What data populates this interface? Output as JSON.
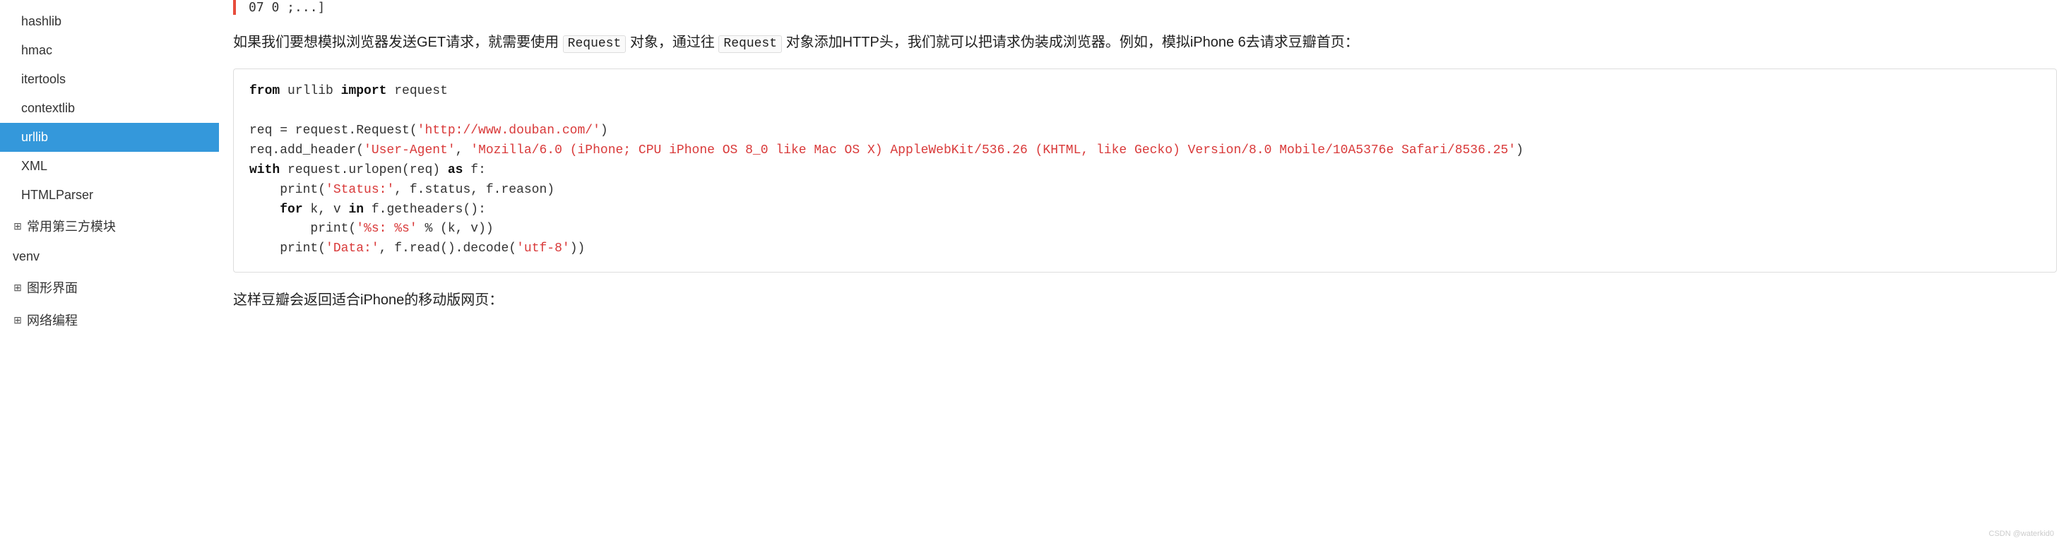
{
  "sidebar": {
    "items": [
      {
        "label": "hashlib",
        "active": false
      },
      {
        "label": "hmac",
        "active": false
      },
      {
        "label": "itertools",
        "active": false
      },
      {
        "label": "contextlib",
        "active": false
      },
      {
        "label": "urllib",
        "active": true
      },
      {
        "label": "XML",
        "active": false
      },
      {
        "label": "HTMLParser",
        "active": false
      }
    ],
    "sections": [
      {
        "label": "常用第三方模块"
      },
      {
        "label": "venv"
      },
      {
        "label": "图形界面"
      },
      {
        "label": "网络编程"
      }
    ]
  },
  "content": {
    "top_code_tail": "07 0 ;...]",
    "para1_prefix": "如果我们要想模拟浏览器发送GET请求，就需要使用 ",
    "inline1": "Request",
    "para1_mid": " 对象，通过往 ",
    "inline2": "Request",
    "para1_suffix": " 对象添加HTTP头，我们就可以把请求伪装成浏览器。例如，模拟iPhone 6去请求豆瓣首页：",
    "code": {
      "l1_kw1": "from",
      "l1_mod": " urllib ",
      "l1_kw2": "import",
      "l1_name": " request",
      "l3": "req = request.Request(",
      "l3_str": "'http://www.douban.com/'",
      "l3_end": ")",
      "l4a": "req.add_header(",
      "l4s1": "'User-Agent'",
      "l4b": ", ",
      "l4s2": "'Mozilla/6.0 (iPhone; CPU iPhone OS 8_0 like Mac OS X) AppleWebKit/536.26 (KHTML, like Gecko) Version/8.0 Mobile/10A5376e Safari/8536.25'",
      "l4c": ")",
      "l5_kw": "with",
      "l5_a": " request.urlopen(req) ",
      "l5_kw2": "as",
      "l5_b": " f:",
      "l6a": "    print(",
      "l6s": "'Status:'",
      "l6b": ", f.status, f.reason)",
      "l7_indent": "    ",
      "l7_kw": "for",
      "l7_a": " k, v ",
      "l7_kw2": "in",
      "l7_b": " f.getheaders():",
      "l8a": "        print(",
      "l8s": "'%s: %s'",
      "l8b": " % (k, v))",
      "l9a": "    print(",
      "l9s": "'Data:'",
      "l9b": ", f.read().decode(",
      "l9s2": "'utf-8'",
      "l9c": "))"
    },
    "para2": "这样豆瓣会返回适合iPhone的移动版网页："
  },
  "watermark": "CSDN @waterkid0"
}
